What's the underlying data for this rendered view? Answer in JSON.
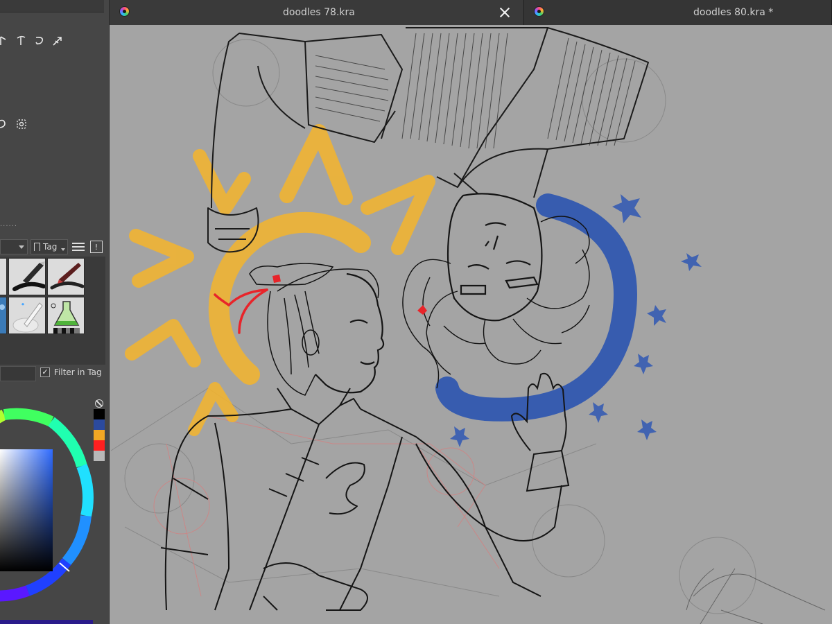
{
  "tabs": [
    {
      "label": "doodles 78.kra",
      "active": true,
      "closable": true
    },
    {
      "label": "doodles 80.kra *",
      "active": false,
      "closable": false
    }
  ],
  "brush_presets": {
    "tag_label": "Tag",
    "filter_in_tag_label": "Filter in Tag",
    "filter_in_tag_checked": true,
    "preset_icons": [
      "ink-pen-preset-icon",
      "brush-pen-preset-icon",
      "blender-preset-icon",
      "wet-brush-preset-icon",
      "chemistry-flask-preset-icon",
      "blue-texture-preset-icon"
    ]
  },
  "color_selector": {
    "swatches": [
      "#000000",
      "#2b4a9e",
      "#f2a724",
      "#ff2020",
      "#b8b8b8"
    ],
    "selected_hue": "#2f6bff"
  },
  "canvas": {
    "background": "#a4a4a4",
    "sun_color": "#f2b430",
    "moon_color": "#2b54b0",
    "ribbon_color": "#e8242a"
  }
}
